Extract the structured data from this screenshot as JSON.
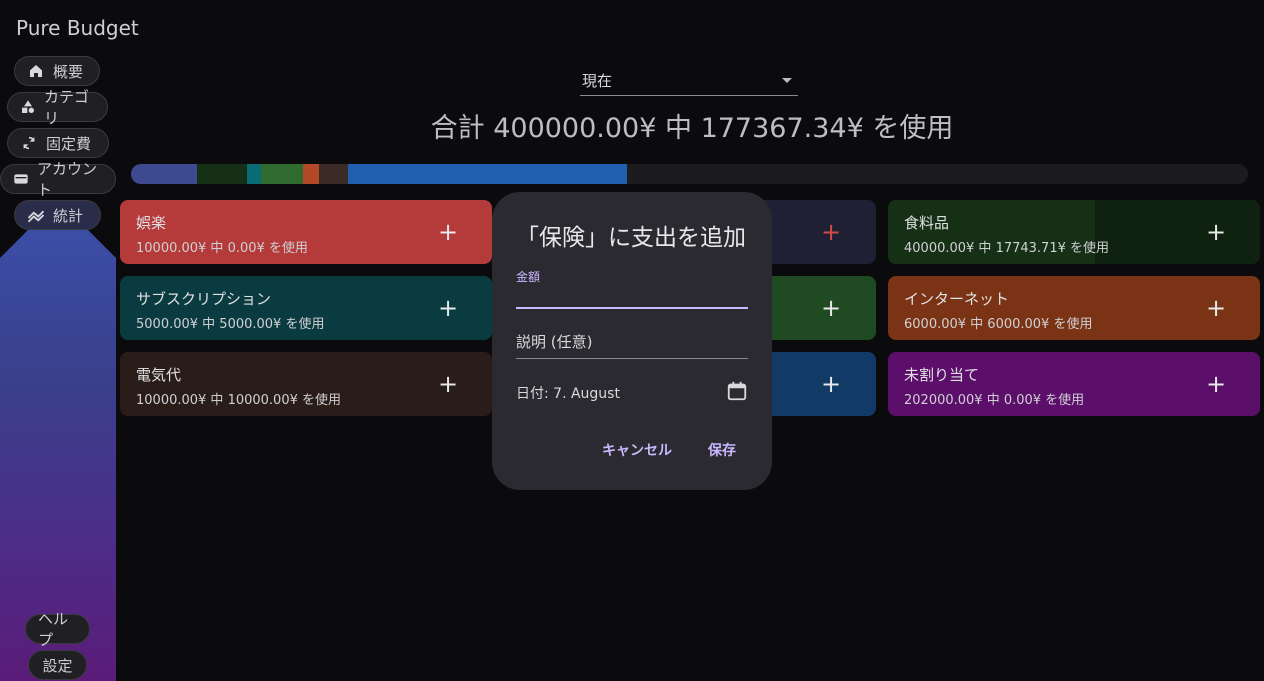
{
  "app": {
    "title": "Pure Budget"
  },
  "sidebar": {
    "items": [
      {
        "label": "概要",
        "icon": "home-icon"
      },
      {
        "label": "カテゴリ",
        "icon": "shapes-icon"
      },
      {
        "label": "固定費",
        "icon": "refresh-icon"
      },
      {
        "label": "アカウント",
        "icon": "wallet-icon"
      },
      {
        "label": "統計",
        "icon": "chart-icon"
      }
    ],
    "bottom": [
      {
        "label": "ヘルプ"
      },
      {
        "label": "設定"
      }
    ]
  },
  "period": {
    "selected": "現在"
  },
  "summary": {
    "text": "合計 400000.00¥ 中 177367.34¥ を使用"
  },
  "cards": [
    {
      "name": "娯楽",
      "sub": "10000.00¥ 中 0.00¥ を使用",
      "color": "#b53a3a"
    },
    {
      "name": "食料品",
      "sub": "40000.00¥ 中 17743.71¥ を使用",
      "color": "#153015"
    },
    {
      "name": "サブスクリプション",
      "sub": "5000.00¥ 中 5000.00¥ を使用",
      "color": "#0a3b40"
    },
    {
      "name": "インターネット",
      "sub": "6000.00¥ 中 6000.00¥ を使用",
      "color": "#7a3415"
    },
    {
      "name": "電気代",
      "sub": "10000.00¥ 中 10000.00¥ を使用",
      "color": "#2e1f1a"
    },
    {
      "name": "未割り当て",
      "sub": "202000.00¥ 中 0.00¥ を使用",
      "color": "#5c0f6a"
    }
  ],
  "dialog": {
    "title": "「保険」に支出を追加",
    "amount_label": "金額",
    "description_placeholder": "説明 (任意)",
    "date_text": "日付: 7. August",
    "cancel": "キャンセル",
    "save": "保存"
  },
  "colors": {
    "accent": "#c9b8ff"
  }
}
